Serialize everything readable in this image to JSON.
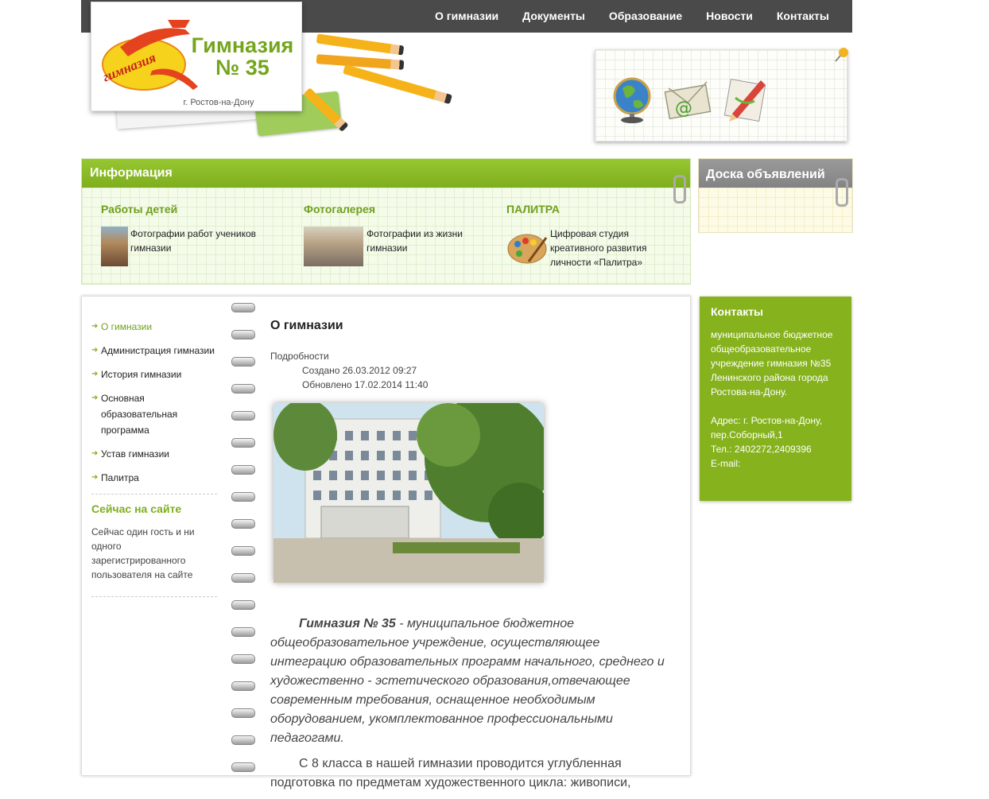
{
  "nav": {
    "items": [
      "О гимназии",
      "Документы",
      "Образование",
      "Новости",
      "Контакты"
    ]
  },
  "logo": {
    "title_line1": "Гимназия",
    "title_line2": "№ 35",
    "city": "г. Ростов-на-Дону",
    "emblem_text": "гимназия"
  },
  "icons": [
    "globe-icon",
    "email-envelope-icon",
    "pencil-notebook-icon"
  ],
  "info": {
    "title": "Информация",
    "columns": [
      {
        "heading": "Работы детей",
        "text": "Фотографии работ учеников гимназии"
      },
      {
        "heading": "Фотогалерея",
        "text": "Фотографии из жизни гимназии"
      },
      {
        "heading": "ПАЛИТРА",
        "text": "Цифровая студия креативного развития личности «Палитра»"
      }
    ]
  },
  "board": {
    "title": "Доска объявлений"
  },
  "menu": {
    "items": [
      {
        "label": "О гимназии",
        "active": true
      },
      {
        "label": "Администрация гимназии",
        "active": false
      },
      {
        "label": "История гимназии",
        "active": false
      },
      {
        "label": "Основная образовательная программа",
        "active": false
      },
      {
        "label": "Устав гимназии",
        "active": false
      },
      {
        "label": "Палитра",
        "active": false
      }
    ]
  },
  "now_on_site": {
    "title": "Сейчас на сайте",
    "text": "Сейчас один гость и ни одного зарегистрированного пользователя на сайте"
  },
  "article": {
    "title": "О гимназии",
    "details_label": "Подробности",
    "created": "Создано 26.03.2012 09:27",
    "updated": "Обновлено 17.02.2014 11:40",
    "lead_bold": "Гимназия № 35",
    "lead_rest": " - муниципальное бюджетное общеобразовательное учреждение, осуществляющее интеграцию образовательных программ начального, среднего и художественно - эстетического образования,отвечающее современным требования, оснащенное необходимым оборудованием, укомплектованное профессиональными педагогами.",
    "para2": "С 8 класса в нашей гимназии проводится углубленная подготовка по предметам художественного цикла: живописи,"
  },
  "contacts": {
    "title": "Контакты",
    "org": "муниципальное бюджетное общеобразовательное учреждение гимназия №35 Ленинского района города Ростова-на-Дону.",
    "address": "Адрес: г. Ростов-на-Дону, пер.Соборный,1",
    "phone": "Тел.: 2402272,2409396",
    "email": "E-mail:"
  },
  "colors": {
    "accent_green": "#86b21d",
    "nav_dark": "#4a4a4a",
    "board_gray": "#8f8f8f"
  }
}
